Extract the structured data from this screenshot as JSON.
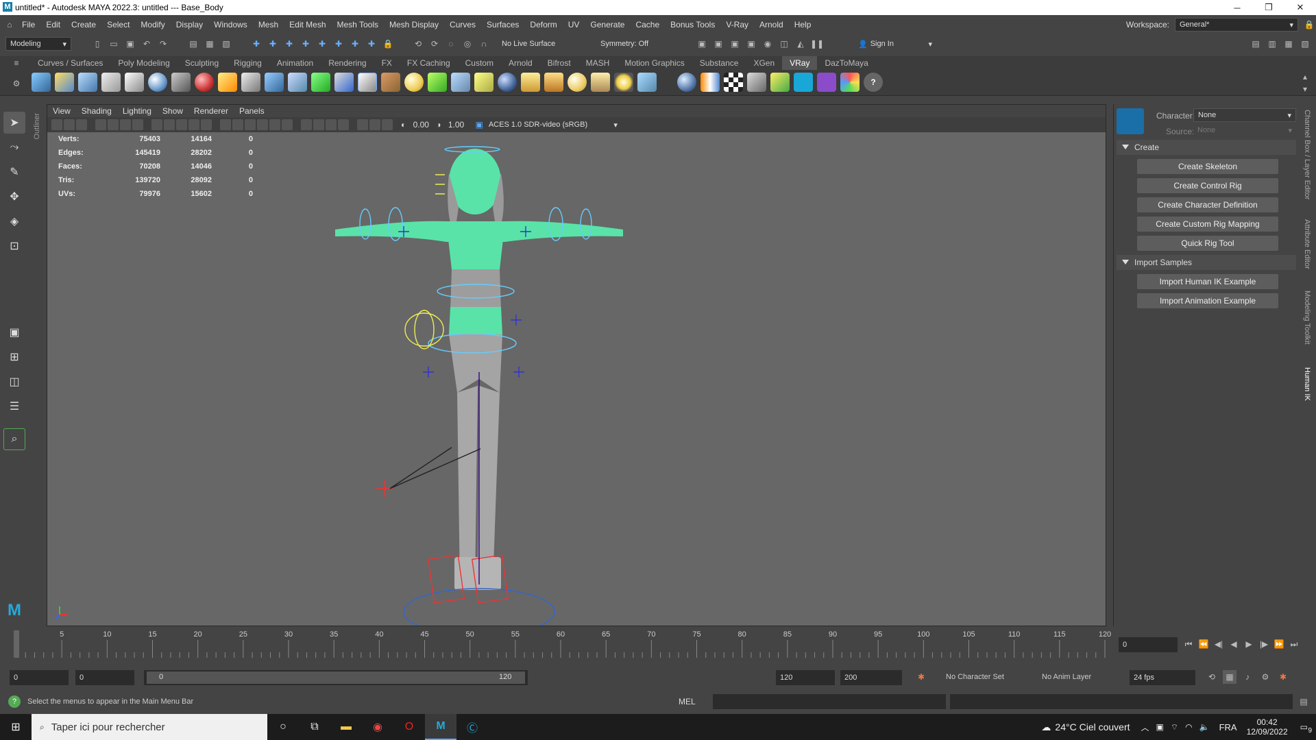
{
  "window": {
    "title": "untitled* - Autodesk MAYA 2022.3: untitled  ---  Base_Body"
  },
  "menus": [
    "File",
    "Edit",
    "Create",
    "Select",
    "Modify",
    "Display",
    "Windows",
    "Mesh",
    "Edit Mesh",
    "Mesh Tools",
    "Mesh Display",
    "Curves",
    "Surfaces",
    "Deform",
    "UV",
    "Generate",
    "Cache",
    "Bonus Tools",
    "V-Ray",
    "Arnold",
    "Help"
  ],
  "workspace": {
    "label": "Workspace:",
    "value": "General*"
  },
  "statusline": {
    "mode": "Modeling",
    "live_surface": "No Live Surface",
    "symmetry": "Symmetry: Off",
    "sign_in": "Sign In"
  },
  "shelf_tabs": [
    "Curves / Surfaces",
    "Poly Modeling",
    "Sculpting",
    "Rigging",
    "Animation",
    "Rendering",
    "FX",
    "FX Caching",
    "Custom",
    "Arnold",
    "Bifrost",
    "MASH",
    "Motion Graphics",
    "Substance",
    "XGen",
    "VRay",
    "DazToMaya"
  ],
  "shelf_active": "VRay",
  "viewport": {
    "menus": [
      "View",
      "Shading",
      "Lighting",
      "Show",
      "Renderer",
      "Panels"
    ],
    "exposure": "0.00",
    "gamma": "1.00",
    "colorspace": "ACES 1.0 SDR-video (sRGB)",
    "hud": [
      {
        "label": "Verts:",
        "v1": "75403",
        "v2": "14164",
        "v3": "0"
      },
      {
        "label": "Edges:",
        "v1": "145419",
        "v2": "28202",
        "v3": "0"
      },
      {
        "label": "Faces:",
        "v1": "70208",
        "v2": "14046",
        "v3": "0"
      },
      {
        "label": "Tris:",
        "v1": "139720",
        "v2": "28092",
        "v3": "0"
      },
      {
        "label": "UVs:",
        "v1": "79976",
        "v2": "15602",
        "v3": "0"
      }
    ]
  },
  "outliner_label": "Outliner",
  "hik": {
    "character_label": "Character:",
    "character_value": "None",
    "source_label": "Source:",
    "source_value": "None",
    "create_header": "Create",
    "create_buttons": [
      "Create Skeleton",
      "Create Control Rig",
      "Create Character Definition",
      "Create Custom Rig Mapping",
      "Quick Rig Tool"
    ],
    "import_header": "Import Samples",
    "import_buttons": [
      "Import Human IK Example",
      "Import Animation Example"
    ]
  },
  "side_tabs": [
    "Channel Box / Layer Editor",
    "Attribute Editor",
    "Modeling Toolkit",
    "Human IK"
  ],
  "timeline": {
    "ticks": [
      "5",
      "10",
      "15",
      "20",
      "25",
      "30",
      "35",
      "40",
      "45",
      "50",
      "55",
      "60",
      "65",
      "70",
      "75",
      "80",
      "85",
      "90",
      "95",
      "100",
      "105",
      "110",
      "115",
      "120"
    ],
    "start_label": "0",
    "current_frame": "0"
  },
  "range": {
    "start": "0",
    "anim_start": "0",
    "slider_start": "0",
    "slider_end": "120",
    "end": "120",
    "anim_end": "200",
    "character_set": "No Character Set",
    "anim_layer": "No Anim Layer",
    "fps": "24 fps"
  },
  "helpline": {
    "text": "Select the menus to appear in the Main Menu Bar",
    "mel_label": "MEL"
  },
  "taskbar": {
    "search_placeholder": "Taper ici pour rechercher",
    "weather": "24°C  Ciel couvert",
    "lang": "FRA",
    "time": "00:42",
    "date": "12/09/2022",
    "notifications": "9"
  }
}
